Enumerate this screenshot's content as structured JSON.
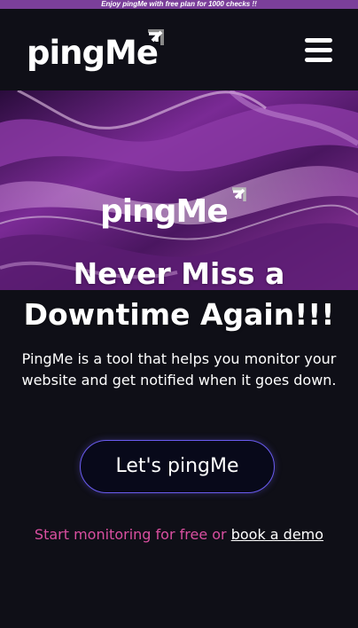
{
  "promo": {
    "text": "Enjoy pingMe with free plan for 1000 checks !!"
  },
  "header": {
    "logo_text": "pingMe",
    "menu_icon": "hamburger-menu-icon"
  },
  "hero": {
    "logo_text": "pingMe",
    "headline": "Never Miss a Downtime Again!!!",
    "description": "PingMe is a tool that helps you monitor your website and get notified when it goes down.",
    "cta_label": "Let's pingMe",
    "footer_text": "Start monitoring for free or ",
    "demo_link_label": "book a demo"
  },
  "colors": {
    "background": "#0f0f17",
    "promo_bar": "#7b3f9a",
    "accent_pink": "#d94fa0",
    "button_border": "#6a5cf0"
  }
}
